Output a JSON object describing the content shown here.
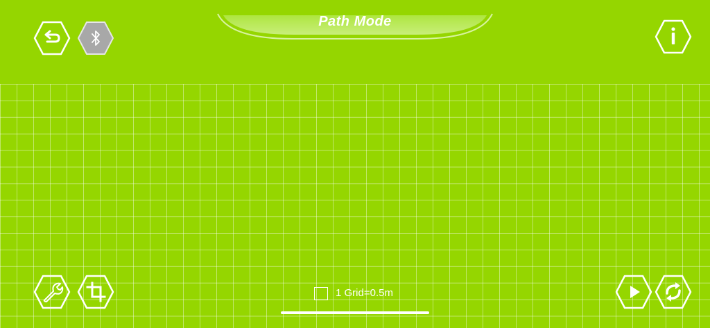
{
  "header": {
    "title": "Path Mode"
  },
  "toolbar_top": {
    "back_icon": "undo-arrow-icon",
    "bluetooth_icon": "bluetooth-icon",
    "info_icon": "info-icon",
    "info_label": "i"
  },
  "toolbar_bottom": {
    "settings_icon": "wrench-icon",
    "crop_icon": "crop-icon",
    "play_icon": "play-icon",
    "reset_icon": "refresh-icon"
  },
  "grid": {
    "scale_label": "1 Grid=0.5m"
  },
  "colors": {
    "background": "#95d600",
    "foreground": "#ffffff",
    "bluetooth_disabled": "#a8a8a8"
  }
}
